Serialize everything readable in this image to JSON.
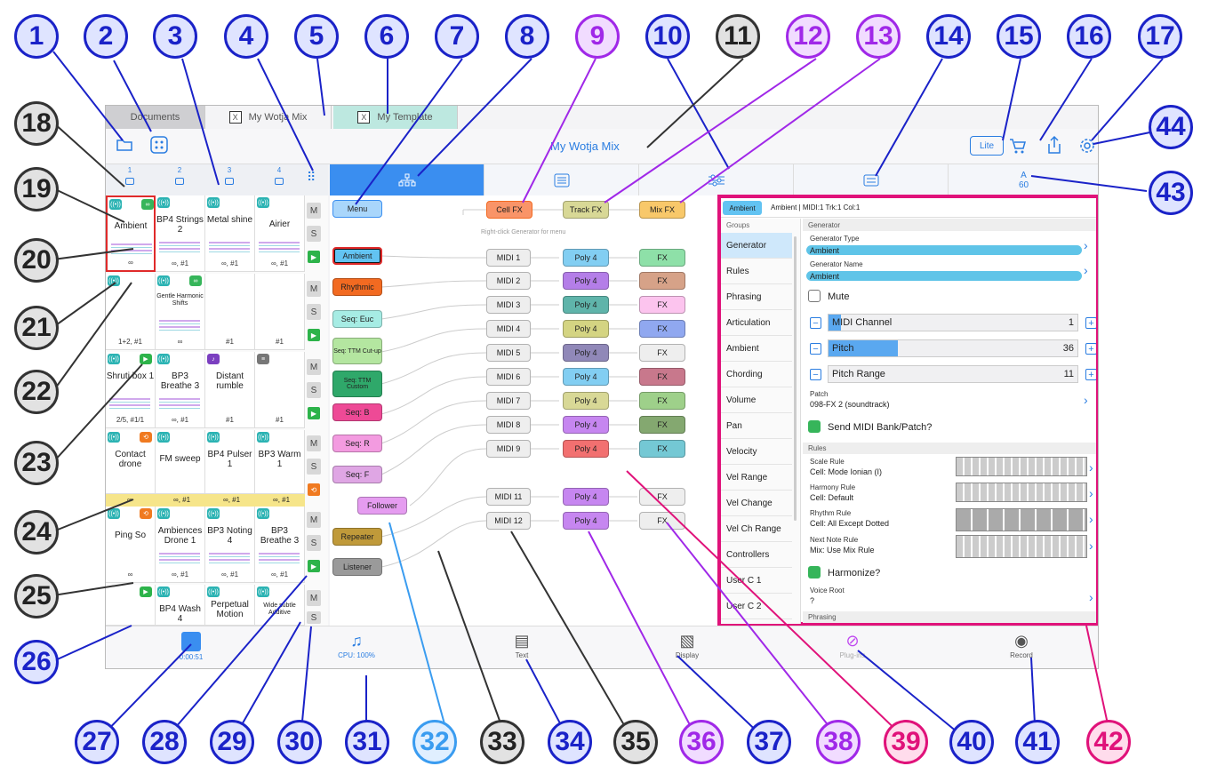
{
  "tabs": [
    "Documents",
    "My Wotja Mix",
    "My Template"
  ],
  "tab_close": "X",
  "title": "My Wotja Mix",
  "lite_button": "Lite",
  "columns": [
    "1",
    "2",
    "3",
    "4"
  ],
  "mixer_header": {
    "letter": "A",
    "value": "60"
  },
  "cells": [
    {
      "name": "Ambient",
      "foot": "∞"
    },
    {
      "name": "BP4 Strings 2",
      "foot": "∞, #1"
    },
    {
      "name": "Metal shine",
      "foot": "∞, #1"
    },
    {
      "name": "Airier",
      "foot": "∞, #1"
    },
    {
      "name": "",
      "foot": "1+2, #1"
    },
    {
      "name": "Gentle Harmonic Shifts",
      "foot": "∞"
    },
    {
      "name": "",
      "foot": "#1"
    },
    {
      "name": "",
      "foot": "#1"
    },
    {
      "name": "Shruti box 1",
      "foot": "2/5, #1/1"
    },
    {
      "name": "BP3 Breathe 3",
      "foot": "∞, #1"
    },
    {
      "name": "Distant rumble",
      "foot": "#1"
    },
    {
      "name": "",
      "foot": "#1"
    },
    {
      "name": "Contact drone",
      "foot": ""
    },
    {
      "name": "FM sweep",
      "foot": ""
    },
    {
      "name": "BP4 Pulser 1",
      "foot": ""
    },
    {
      "name": "BP3 Warm 1",
      "foot": ""
    },
    {
      "name": "Ping So",
      "foot": "∞"
    },
    {
      "name": "Ambiences Drone 1",
      "foot": "∞, #1"
    },
    {
      "name": "BP3 Noting 4",
      "foot": "∞, #1"
    },
    {
      "name": "BP3 Breathe 3",
      "foot": "∞, #1"
    },
    {
      "name": "",
      "foot": ""
    },
    {
      "name": "BP4 Wash 4",
      "foot": ""
    },
    {
      "name": "Perpetual Motion",
      "foot": ""
    },
    {
      "name": "Wide subtle Additive",
      "foot": ""
    }
  ],
  "row4_footer": [
    "∞",
    "∞, #1",
    "∞, #1",
    "∞, #1"
  ],
  "ms_labels": {
    "m": "M",
    "s": "S"
  },
  "generators": [
    "Menu",
    "Ambient",
    "Rhythmic",
    "Seq: Euc",
    "Seq: TTM Cut-up",
    "Seq: TTM Custom",
    "Seq: B",
    "Seq: R",
    "Seq: F",
    "Follower",
    "Repeater",
    "Listener"
  ],
  "fx_top": [
    "Cell FX",
    "Track FX",
    "Mix FX"
  ],
  "hint": "Right-click Generator for menu",
  "midi": [
    "MIDI 1",
    "MIDI 2",
    "MIDI 3",
    "MIDI 4",
    "MIDI 5",
    "MIDI 6",
    "MIDI 7",
    "MIDI 8",
    "MIDI 9",
    "MIDI 11",
    "MIDI 12"
  ],
  "poly": "Poly 4",
  "fx": "FX",
  "panel": {
    "header_btn": "Ambient",
    "header_info": "Ambient | MIDI:1 Trk:1 Col:1",
    "groups_label": "Groups",
    "groups": [
      "Generator",
      "Rules",
      "Phrasing",
      "Articulation",
      "Ambient",
      "Chording",
      "Volume",
      "Pan",
      "Velocity",
      "Vel Range",
      "Vel Change",
      "Vel Ch Range",
      "Controllers",
      "User C 1",
      "User C 2"
    ],
    "section_title": "Generator",
    "gen_type_label": "Generator Type",
    "gen_type_value": "Ambient",
    "gen_name_label": "Generator Name",
    "gen_name_value": "Ambient",
    "mute_label": "Mute",
    "midi_channel_label": "MIDI Channel",
    "midi_channel_value": "1",
    "pitch_label": "Pitch",
    "pitch_value": "36",
    "pitch_range_label": "Pitch Range",
    "pitch_range_value": "11",
    "patch_label": "Patch",
    "patch_value": "098-FX 2 (soundtrack)",
    "send_midi_label": "Send MIDI Bank/Patch?",
    "rules_title": "Rules",
    "scale_rule_label": "Scale Rule",
    "scale_rule_value": "Cell: Mode Ionian (I)",
    "harmony_rule_label": "Harmony Rule",
    "harmony_rule_value": "Cell: Default",
    "rhythm_rule_label": "Rhythm Rule",
    "rhythm_rule_value": "Cell: All Except Dotted",
    "next_note_label": "Next Note Rule",
    "next_note_value": "Mix: Use Mix Rule",
    "harmonize_label": "Harmonize?",
    "voice_root_label": "Voice Root",
    "voice_root_value": "?",
    "phrasing_title": "Phrasing"
  },
  "bottom": [
    {
      "label": "0:00:51",
      "icon": "stop-icon"
    },
    {
      "label": "CPU: 100%",
      "icon": "music-note-icon"
    },
    {
      "label": "Text",
      "icon": "text-doc-icon"
    },
    {
      "label": "Display",
      "icon": "image-icon"
    },
    {
      "label": "Plug-ins",
      "icon": "plugin-icon"
    },
    {
      "label": "Record",
      "icon": "record-icon"
    }
  ],
  "callouts": [
    "1",
    "2",
    "3",
    "4",
    "5",
    "6",
    "7",
    "8",
    "9",
    "10",
    "11",
    "12",
    "13",
    "14",
    "15",
    "16",
    "17",
    "18",
    "19",
    "20",
    "21",
    "22",
    "23",
    "24",
    "25",
    "26",
    "27",
    "28",
    "29",
    "30",
    "31",
    "32",
    "33",
    "34",
    "35",
    "36",
    "37",
    "38",
    "39",
    "40",
    "41",
    "42",
    "43",
    "44"
  ],
  "colors": {
    "accent": "#2a7de1",
    "callout_blue": "#1a22c8",
    "callout_purple": "#a028e8",
    "callout_magenta": "#e0127a",
    "callout_gray": "#333333",
    "panel_border": "#e0127a"
  }
}
